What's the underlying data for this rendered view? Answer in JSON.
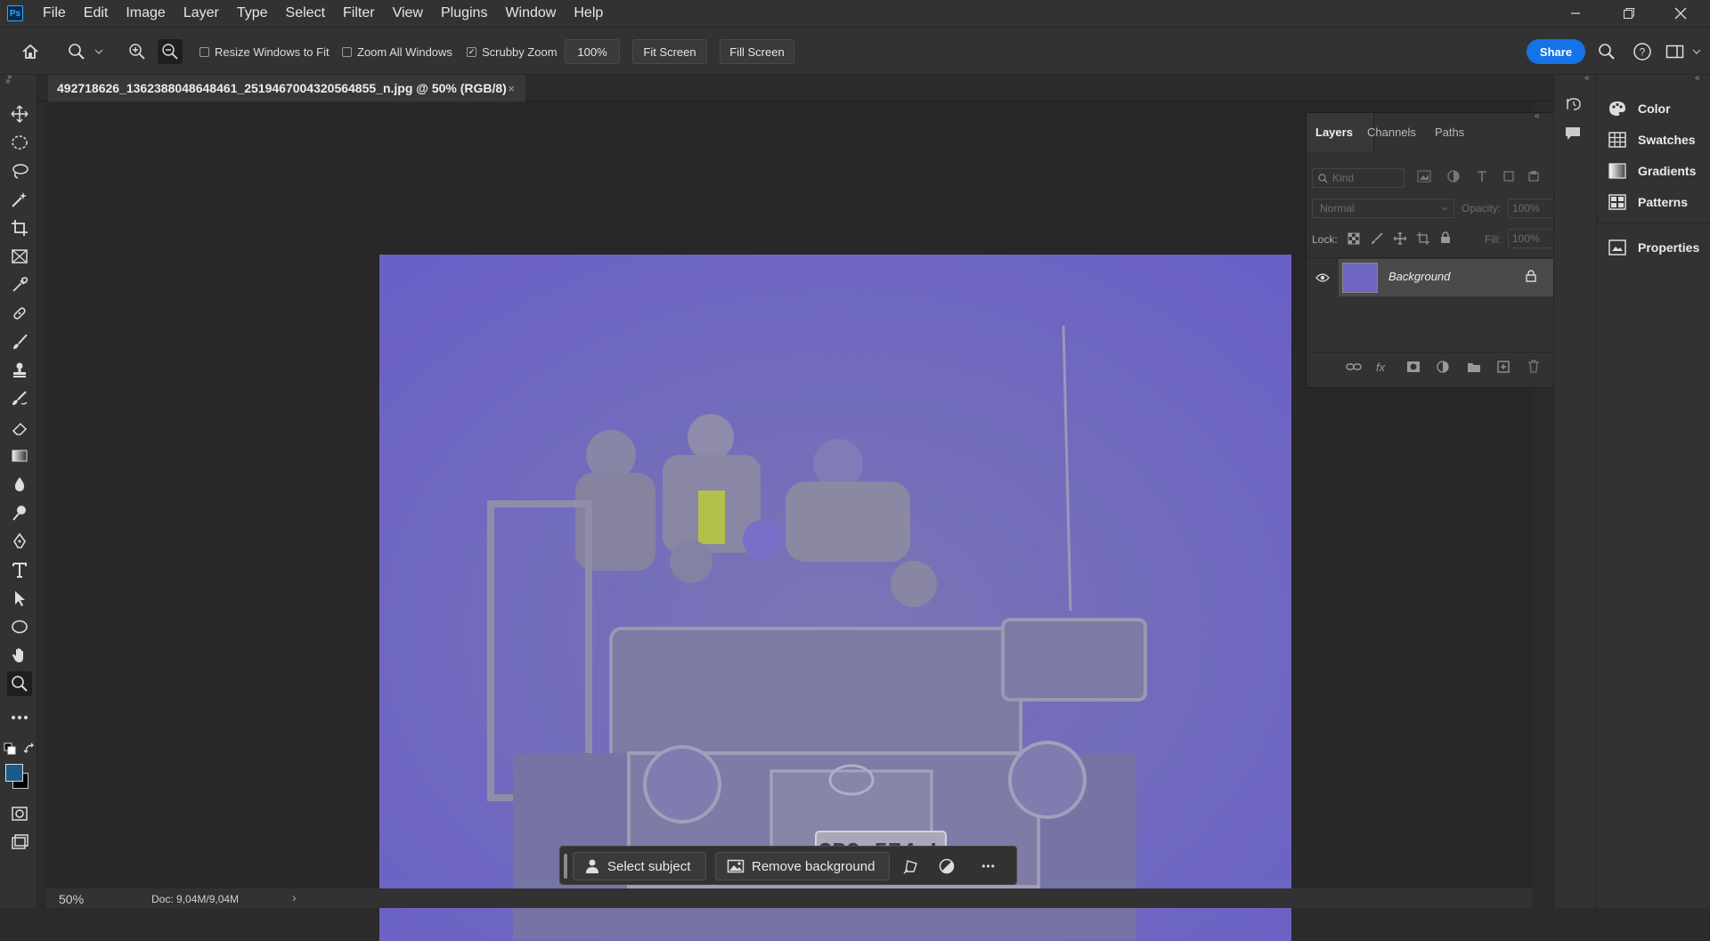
{
  "menu": [
    "File",
    "Edit",
    "Image",
    "Layer",
    "Type",
    "Select",
    "Filter",
    "View",
    "Plugins",
    "Window",
    "Help"
  ],
  "app_logo": "Ps",
  "options": {
    "resize_windows": "Resize Windows to Fit",
    "zoom_all": "Zoom All Windows",
    "scrubby": "Scrubby Zoom",
    "zoom_value": "100%",
    "fit_screen": "Fit Screen",
    "fill_screen": "Fill Screen",
    "share": "Share"
  },
  "document": {
    "tab_title": "492718626_1362388048648461_2519467004320564855_n.jpg @ 50% (RGB/8)",
    "close": "×",
    "plate": "CPG 574 L"
  },
  "status": {
    "zoom": "50%",
    "doc": "Doc: 9,04M/9,04M",
    "arrow": "›"
  },
  "context_bar": {
    "select_subject": "Select subject",
    "remove_background": "Remove background",
    "more": "•••"
  },
  "layers_panel": {
    "tabs": [
      "Layers",
      "Channels",
      "Paths"
    ],
    "kind": "Kind",
    "blend": "Normal",
    "opacity_label": "Opacity:",
    "opacity_value": "100%",
    "lock_label": "Lock:",
    "fill_label": "Fill:",
    "fill_value": "100%",
    "layer_name": "Background",
    "fx": "fx"
  },
  "right_panels": [
    "Color",
    "Swatches",
    "Gradients",
    "Patterns",
    "Properties"
  ],
  "colors": {
    "accent": "#1473e6",
    "foreground": "#1b5a8a",
    "background": "#000000",
    "image_tint": "#6f66c2"
  }
}
